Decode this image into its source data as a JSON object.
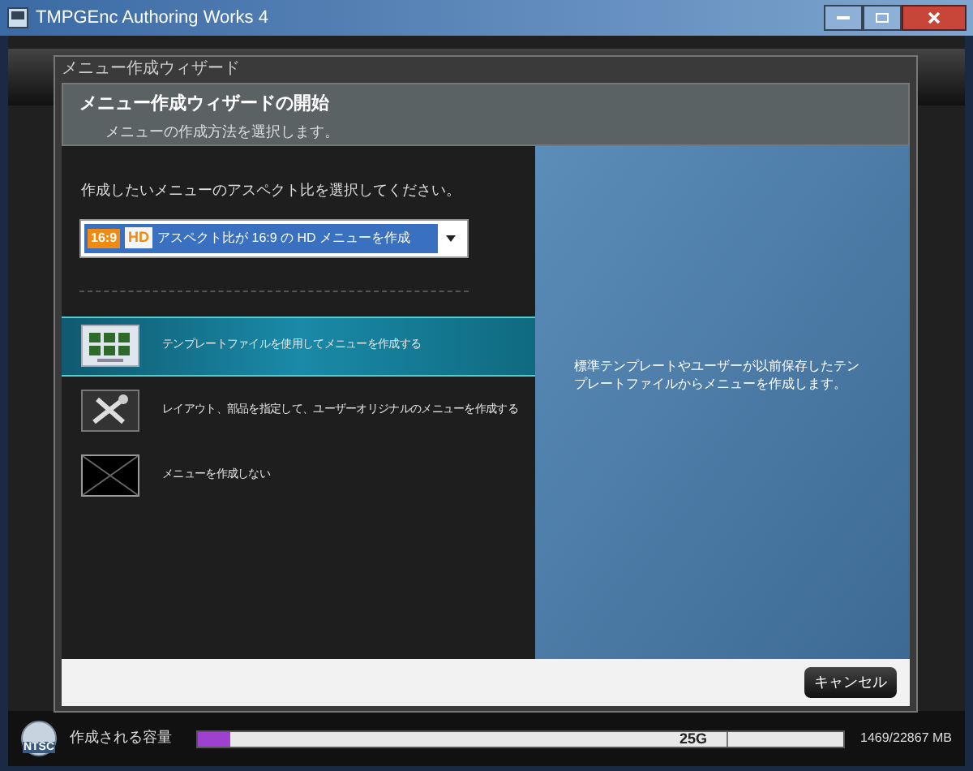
{
  "window": {
    "title": "TMPGEnc Authoring Works 4"
  },
  "dialog": {
    "title": "メニュー作成ウィザード",
    "heading": "メニュー作成ウィザードの開始",
    "subheading": "メニューの作成方法を選択します。",
    "prompt": "作成したいメニューのアスペクト比を選択してください。",
    "aspect_select": {
      "ratio_badge": "16:9",
      "hd_badge": "HD",
      "value": "アスペクト比が 16:9 の HD メニューを作成"
    },
    "options": [
      {
        "kind": "template",
        "label": "テンプレートファイルを使用してメニューを作成する",
        "selected": true
      },
      {
        "kind": "custom",
        "label": "レイアウト、部品を指定して、ユーザーオリジナルのメニューを作成する",
        "selected": false
      },
      {
        "kind": "none",
        "label": "メニューを作成しない",
        "selected": false
      }
    ],
    "description": "標準テンプレートやユーザーが以前保存したテンプレートファイルからメニューを作成します。",
    "buttons": [
      "キャンセル"
    ]
  },
  "status_bar": {
    "disc_label": "NTSC",
    "capacity_label": "作成される容量",
    "level": 0.05,
    "marker": "25G",
    "usage": "1469/22867 MB"
  }
}
